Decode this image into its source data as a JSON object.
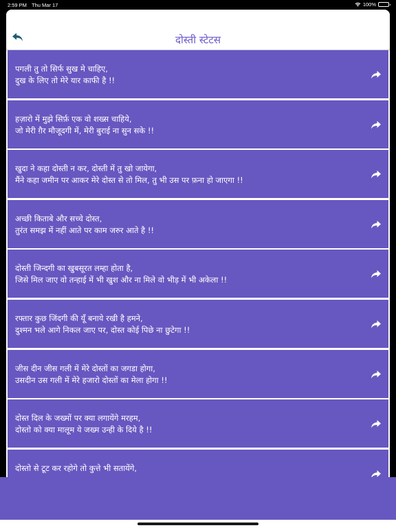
{
  "status_bar": {
    "time": "2:59 PM",
    "date": "Thu Mar 17",
    "battery": "100%"
  },
  "nav": {
    "title": "दोस्ती स्टेटस",
    "back_icon": "back-arrow-icon"
  },
  "colors": {
    "accent": "#6757c0",
    "title": "#6a5acd"
  },
  "statuses": [
    {
      "line1": "पगली तु तो सिर्फ सुख मे चाहिए,",
      "line2": "दुख के लिए तो मेरे यार काफी है !!"
    },
    {
      "line1": "हज़ारो में मुझे सिर्फ़ एक वो शख्स चाहिये,",
      "line2": "जो मेरी ग़ैर मौजूदगी में, मेरी बुराई ना सुन सके !!"
    },
    {
      "line1": "खुदा ने कहा दोस्ती न कर, दोस्ती में तु खो जायेगा,",
      "line2": "मैंने कहा जमीन पर आकर मेरे दोस्त से तो मिल, तु भी उस पर फ़ना हो जाएगा !!"
    },
    {
      "line1": "अच्छी किताबे और सच्चे दोस्त,",
      "line2": "तुरंत समझ में नहीं आते पर काम जरुर आते है !!"
    },
    {
      "line1": "दोस्ती जिन्दगी का खुबसूरत लम्हा होता है,",
      "line2": "जिसे मिल जाए वो तन्हाई में भी खुश और ना मिले वो भीड़ में भी अकेला !!"
    },
    {
      "line1": "रफ्तार कुछ जिंदगी की यूँ बनाये रखी है हमने,",
      "line2": "दुश्मन भले आगे निकल जाए पर, दोस्त कोई पिछे ना छुटेगा !!"
    },
    {
      "line1": "जीस दीन जीस गली में मेरे दोस्तों का जगडा होगा,",
      "line2": "उसदीन उस गली में मेरे हजारो दोस्तों का मेला होगा !!"
    },
    {
      "line1": "दोस्त दिल के जख्मों पर क्या लगायेंगे मरहम,",
      "line2": "दोस्तो को क्या मालूम ये जख्म उन्ही के दिये है !!"
    },
    {
      "line1": "दोस्तो से टूट कर रहोगे तो कुत्ते भी सतायेंगे,",
      "line2": ""
    }
  ]
}
